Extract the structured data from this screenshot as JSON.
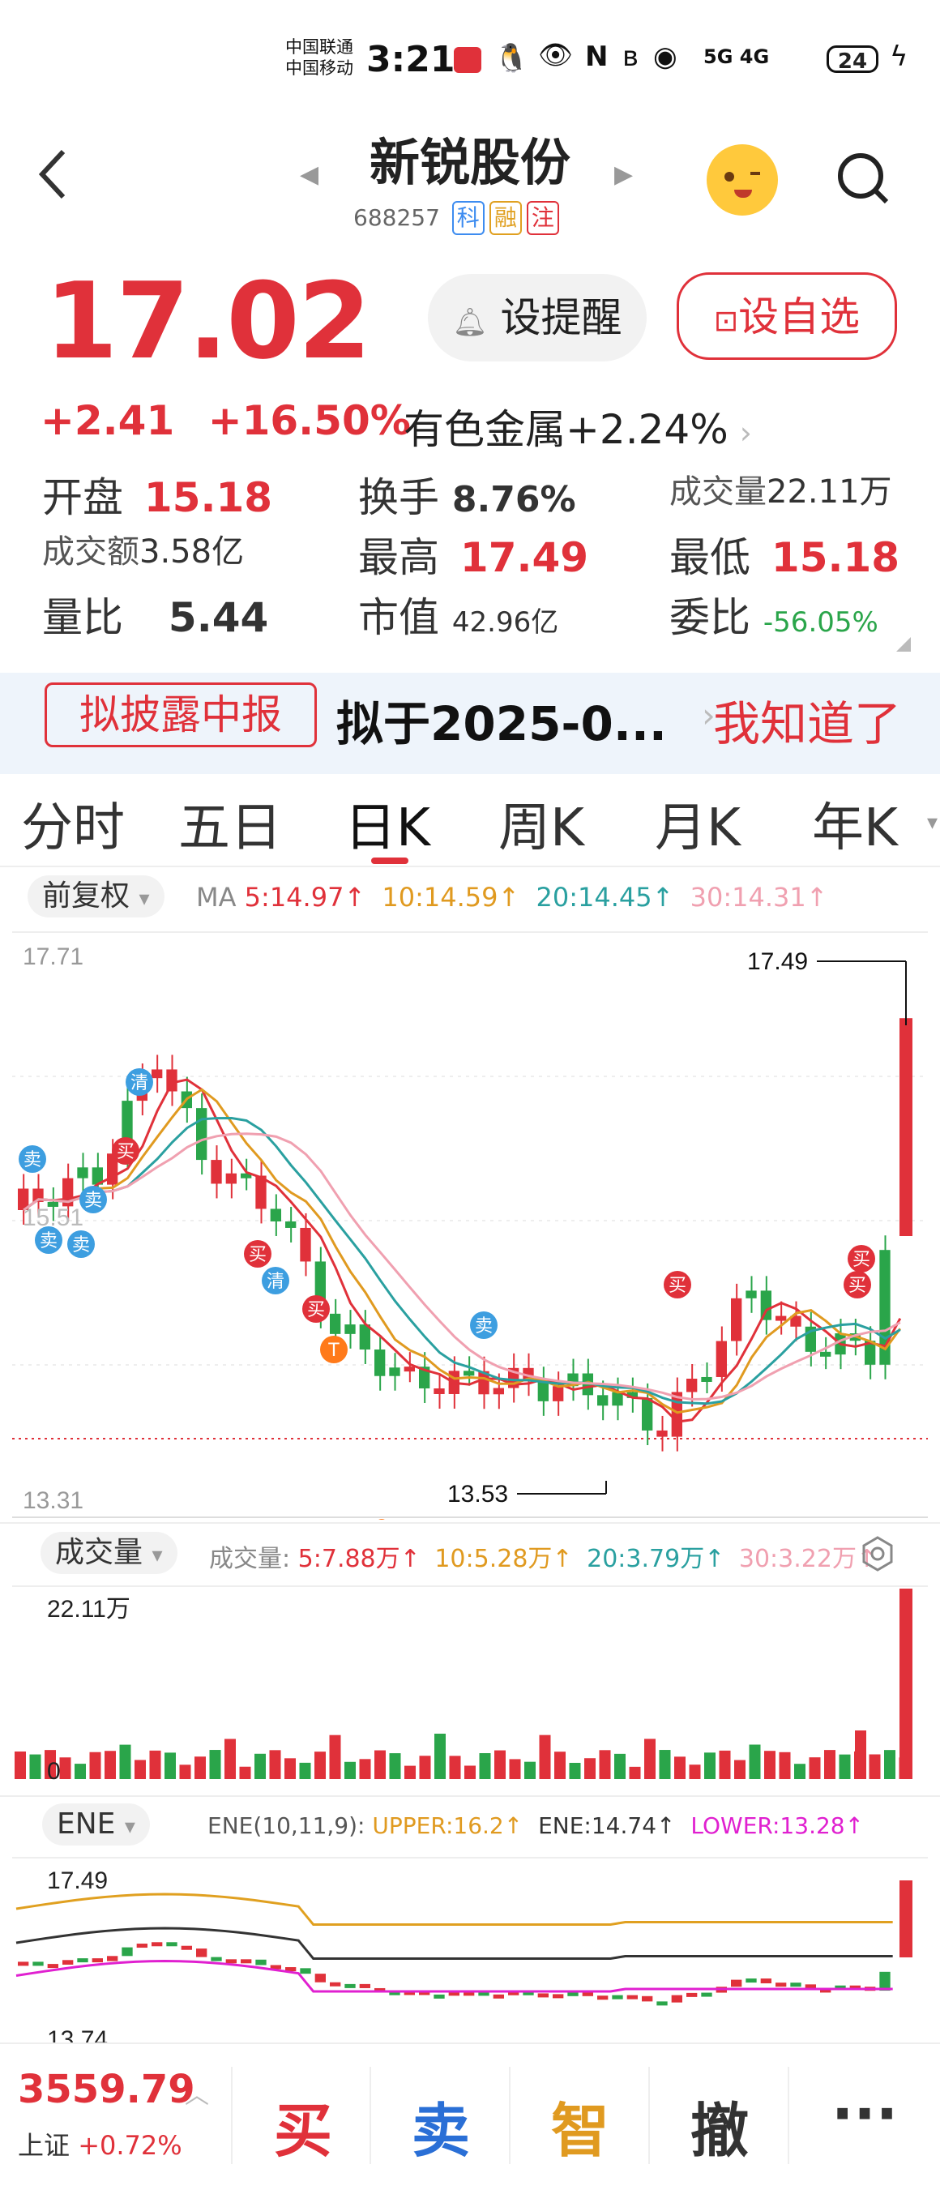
{
  "status": {
    "carrier1": "中国联通",
    "carrier2": "中国移动",
    "time": "3:21",
    "battery": "24",
    "signal": "5G 4G"
  },
  "header": {
    "back_icon": "back-icon",
    "title": "新锐股份",
    "code": "688257",
    "tags": [
      "科",
      "融",
      "注"
    ],
    "tag_colors": [
      "#3d8cf0",
      "#e0a020",
      "#e0313a"
    ]
  },
  "quote": {
    "price": "17.02",
    "change": "+2.41",
    "change_pct": "+16.50%",
    "sector": "有色金属+2.24%",
    "remind_label": "设提醒",
    "fav_label": "设自选",
    "stats": {
      "open_label": "开盘",
      "open": "15.18",
      "turnover_label": "换手",
      "turnover": "8.76%",
      "volume_label": "成交量",
      "volume": "22.11万",
      "amount_label": "成交额",
      "amount": "3.58亿",
      "high_label": "最高",
      "high": "17.49",
      "low_label": "最低",
      "low": "15.18",
      "ratio_label": "量比",
      "ratio": "5.44",
      "mcap_label": "市值",
      "mcap": "42.96亿",
      "commit_label": "委比",
      "commit": "-56.05%"
    }
  },
  "banner": {
    "tag": "拟披露中报",
    "text": "拟于2025-0...",
    "action": "我知道了"
  },
  "tabs": [
    "分时",
    "五日",
    "日K",
    "周K",
    "月K",
    "年K"
  ],
  "kline": {
    "adj_label": "前复权",
    "ma_label": "MA",
    "ma5": "5:14.97↑",
    "ma10": "10:14.59↑",
    "ma20": "20:14.45↑",
    "ma30": "30:14.31↑",
    "ma_colors": {
      "ma5": "#e0313a",
      "ma10": "#e09a20",
      "ma20": "#2aa0a0",
      "ma30": "#f0a0b0"
    },
    "y_top": "17.71",
    "y_mid": "15.51",
    "y_bottom": "13.31",
    "high_mark": "17.49",
    "low_mark": "13.53",
    "markers": {
      "buy": "买",
      "sell": "卖",
      "clear": "清",
      "t": "T"
    }
  },
  "volume": {
    "label": "成交量",
    "title": "成交量:",
    "v5": "5:7.88万↑",
    "v10": "10:5.28万↑",
    "v20": "20:3.79万↑",
    "v30": "30:3.22万↑",
    "max": "22.11万",
    "zero": "0"
  },
  "ene": {
    "label": "ENE",
    "params": "ENE(10,11,9):",
    "upper": "UPPER:16.2↑",
    "mid": "ENE:14.74↑",
    "lower": "LOWER:13.28↑",
    "top": "17.49",
    "bottom": "13.74"
  },
  "bottom": {
    "index_value": "3559.79",
    "index_name": "上证",
    "index_pct": "+0.72%",
    "buy": "买",
    "sell": "卖",
    "smart": "智",
    "cancel": "撤",
    "more": "···"
  }
}
